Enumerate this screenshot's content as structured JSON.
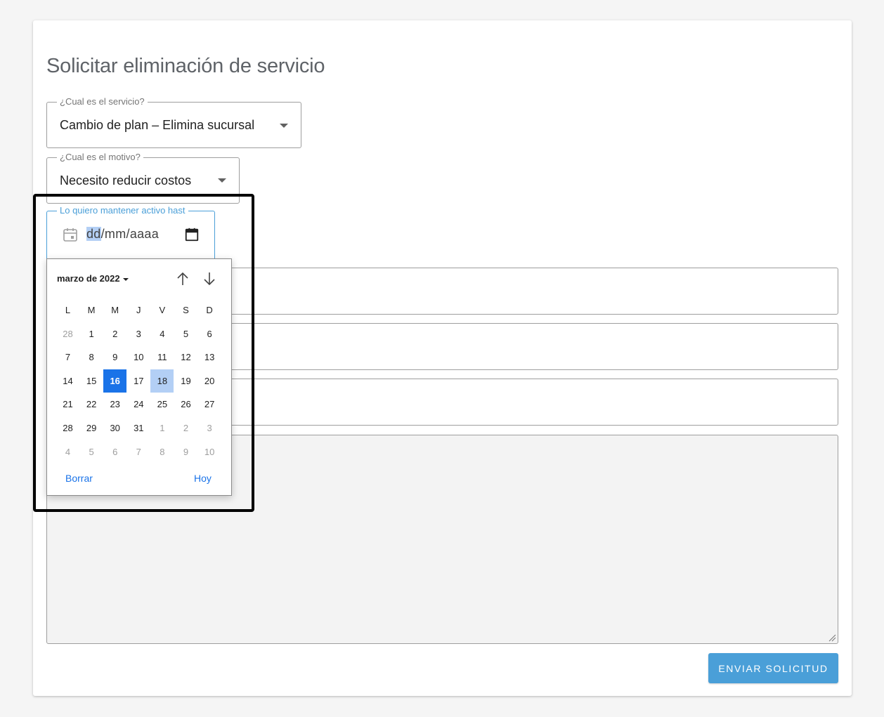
{
  "page": {
    "title": "Solicitar eliminación de servicio"
  },
  "service_select": {
    "label": "¿Cual es el servicio?",
    "value": "Cambio de plan – Elimina sucursal"
  },
  "reason_select": {
    "label": "¿Cual es el motivo?",
    "value": "Necesito reducir costos"
  },
  "date_field": {
    "label": "Lo quiero mantener activo hast",
    "day_segment": "dd",
    "rest_segments": "/mm/aaaa"
  },
  "datepicker": {
    "month_label": "marzo de 2022",
    "weekdays": [
      "L",
      "M",
      "M",
      "J",
      "V",
      "S",
      "D"
    ],
    "weeks": [
      [
        "28",
        "1",
        "2",
        "3",
        "4",
        "5",
        "6"
      ],
      [
        "7",
        "8",
        "9",
        "10",
        "11",
        "12",
        "13"
      ],
      [
        "14",
        "15",
        "16",
        "17",
        "18",
        "19",
        "20"
      ],
      [
        "21",
        "22",
        "23",
        "24",
        "25",
        "26",
        "27"
      ],
      [
        "28",
        "29",
        "30",
        "31",
        "1",
        "2",
        "3"
      ],
      [
        "4",
        "5",
        "6",
        "7",
        "8",
        "9",
        "10"
      ]
    ],
    "selected_day": "16",
    "focused_day": "18",
    "clear_label": "Borrar",
    "today_label": "Hoy"
  },
  "actions": {
    "submit_label": "ENVIAR SOLICITUD"
  },
  "colors": {
    "accent": "#4a9fd8",
    "selected": "#1a73e8",
    "focused": "#b3cff5"
  }
}
